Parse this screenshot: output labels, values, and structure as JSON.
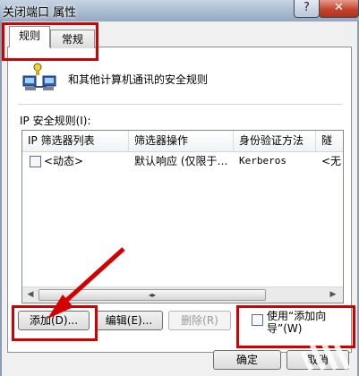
{
  "window": {
    "title": "关闭端口 属性",
    "help_glyph": "?",
    "close_glyph": "✕"
  },
  "tabs": [
    {
      "label": "规则",
      "selected": true
    },
    {
      "label": "常规",
      "selected": false
    }
  ],
  "rules_tab": {
    "description": "和其他计算机通讯的安全规则",
    "section_label": "IP 安全规则(I):",
    "columns": [
      "IP 筛选器列表",
      "筛选器操作",
      "身份验证方法",
      "隧"
    ],
    "rows": [
      {
        "checked": false,
        "filter_list": "<动态>",
        "filter_action": "默认响应 (仅限于…",
        "auth_method": "Kerberos",
        "tunnel": "<无"
      }
    ]
  },
  "buttons": {
    "add": "添加(D)...",
    "edit": "编辑(E)...",
    "remove": "删除(R)",
    "wizard_line1": "使用“添加向",
    "wizard_line2": "导”(W)",
    "ok": "确定",
    "cancel": "取消"
  },
  "annotation_color": "#d40000",
  "icons": {
    "network": "network-computers-icon",
    "scroll_left": "scroll-left-icon",
    "scroll_right": "scroll-right-icon"
  }
}
